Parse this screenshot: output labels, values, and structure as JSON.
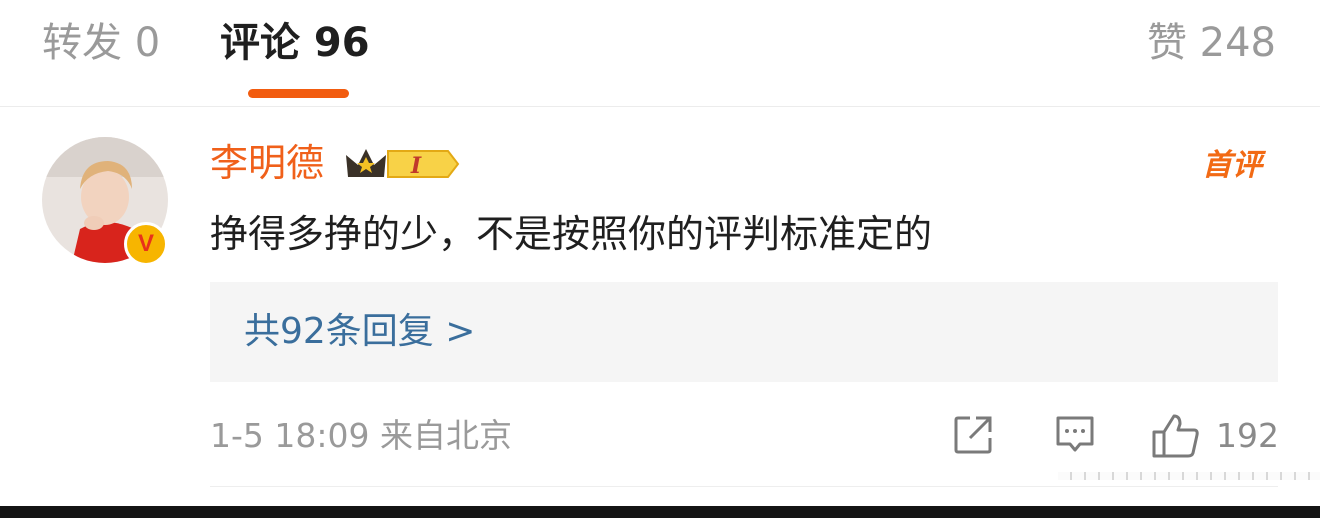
{
  "tabs": {
    "repost": "转发 0",
    "comments": "评论 96",
    "likes": "赞 248"
  },
  "comment": {
    "username": "李明德",
    "vip_level": "I",
    "first_comment_badge": "首评",
    "text": "挣得多挣的少，不是按照你的评判标准定的",
    "replies_link": "共92条回复 >",
    "meta": "1-5 18:09 来自北京",
    "like_count": "192",
    "verify_badge": "V"
  },
  "colors": {
    "accent": "#f25c0f",
    "username": "#f0601a",
    "link": "#3a6e9c"
  },
  "icons": [
    "share-icon",
    "reply-icon",
    "like-icon",
    "crown-icon"
  ]
}
